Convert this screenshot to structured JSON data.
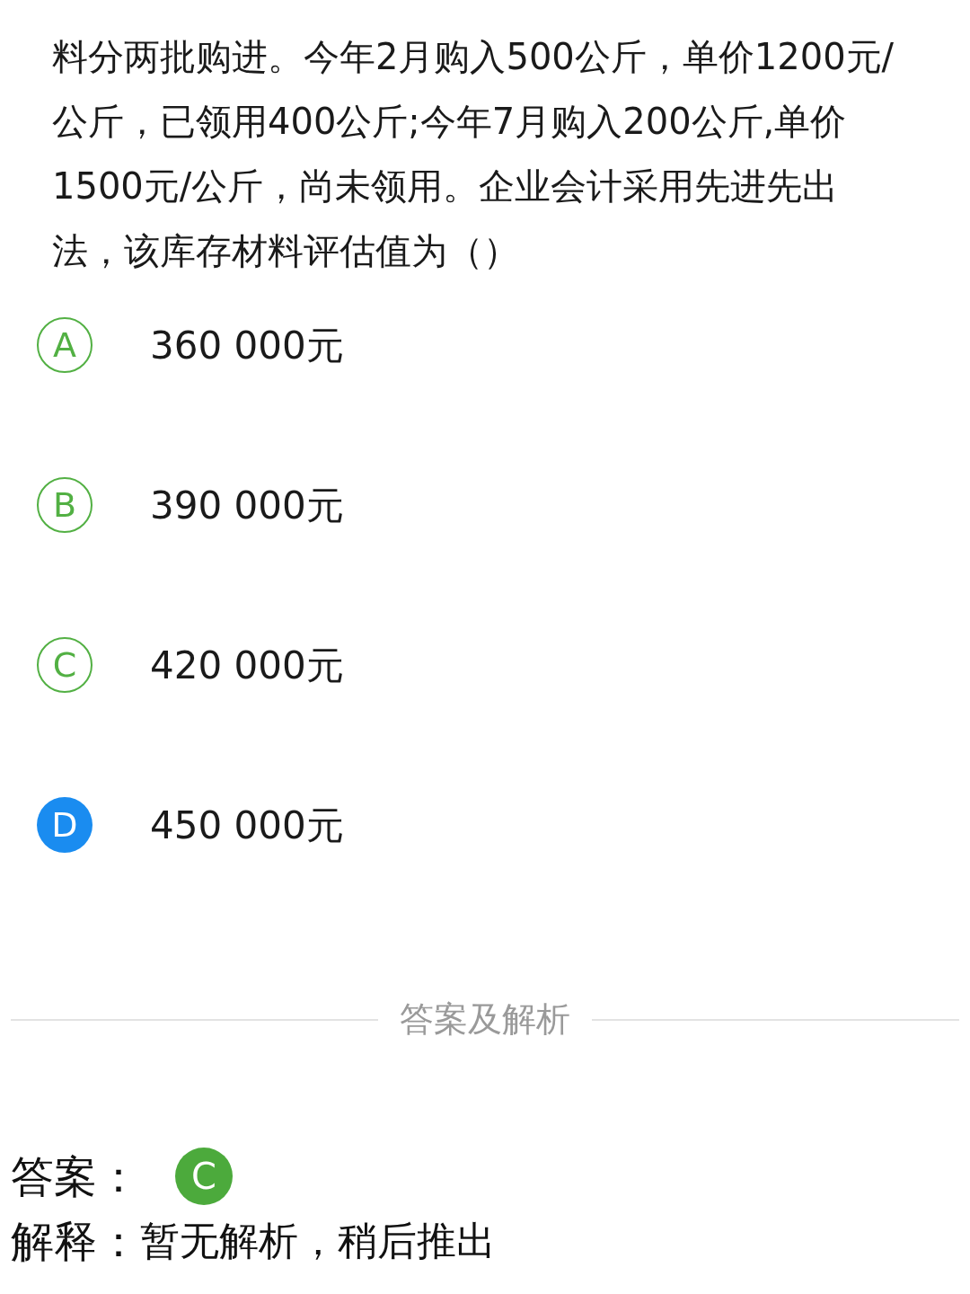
{
  "question": "料分两批购进。今年2月购入500公斤，单价1200元/公斤，已领用400公斤;今年7月购入200公斤,单价1500元/公斤，尚未领用。企业会计采用先进先出法，该库存材料评估值为（）",
  "options": [
    {
      "letter": "A",
      "text": "360 000元",
      "selected": false
    },
    {
      "letter": "B",
      "text": "390 000元",
      "selected": false
    },
    {
      "letter": "C",
      "text": "420 000元",
      "selected": false
    },
    {
      "letter": "D",
      "text": "450 000元",
      "selected": true
    }
  ],
  "divider_label": "答案及解析",
  "answer": {
    "label": "答案：",
    "letter": "C"
  },
  "explanation": {
    "label": "解释：",
    "text": "暂无解析，稍后推出"
  }
}
